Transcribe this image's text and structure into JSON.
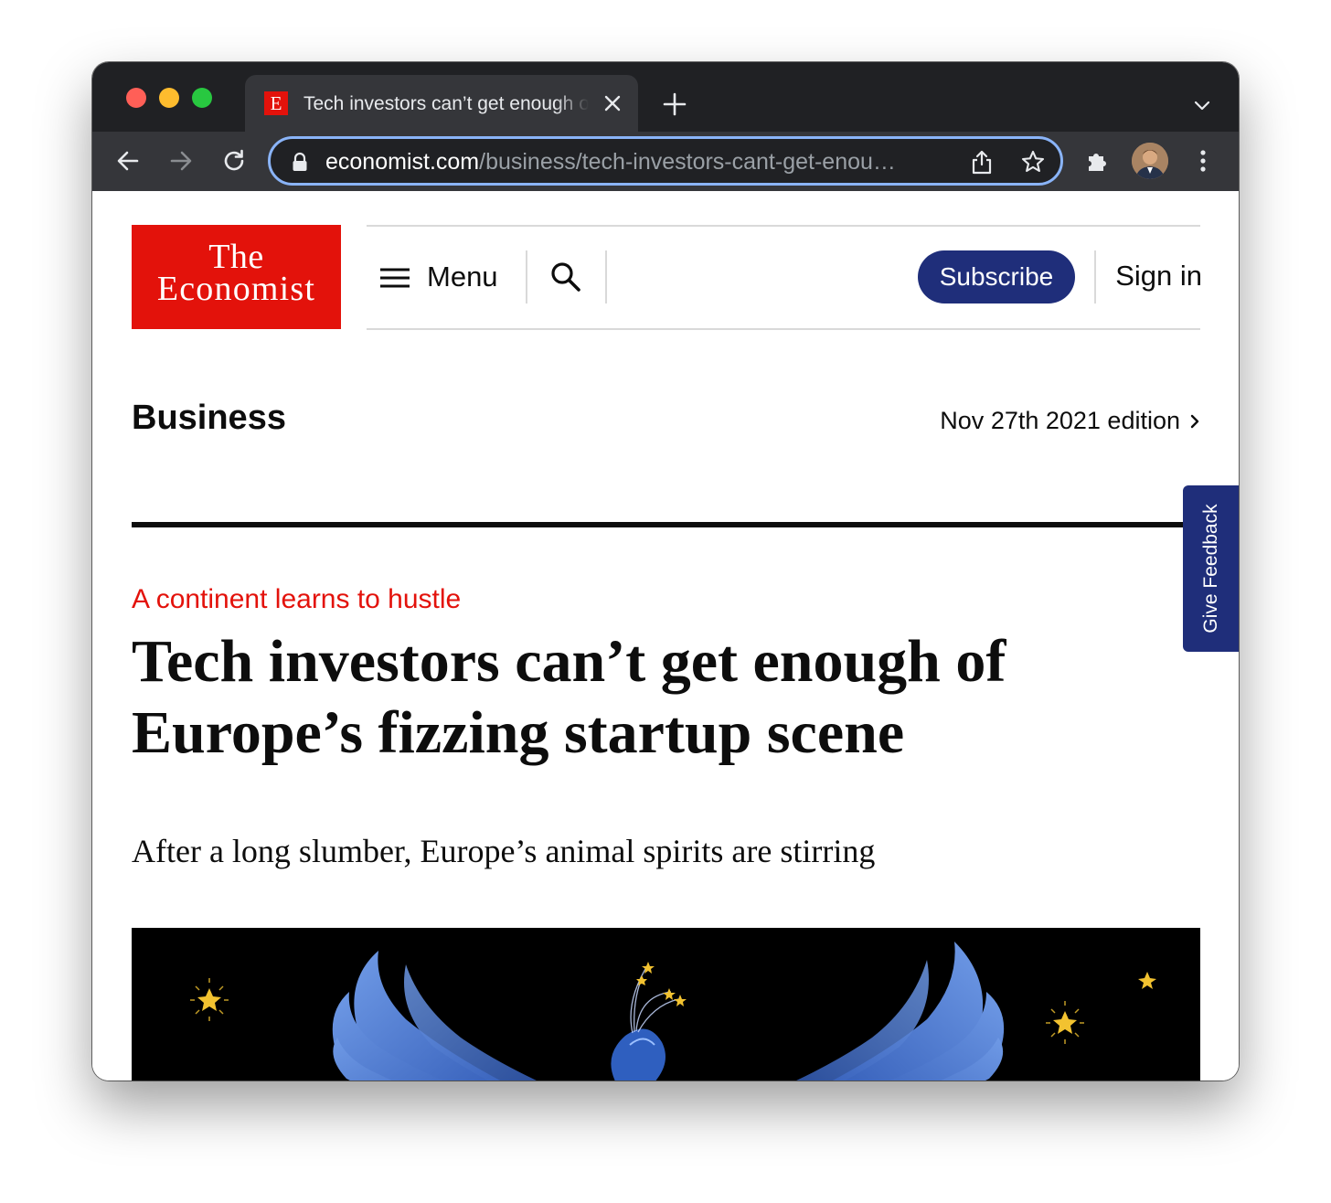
{
  "browser": {
    "tab": {
      "favicon_letter": "E",
      "title": "Tech investors can’t get enough of Europe’s fizzing startup scene"
    },
    "url": {
      "host": "economist.com",
      "path": "/business/tech-investors-cant-get-enou…"
    }
  },
  "site": {
    "logo_line1": "The",
    "logo_line2": "Economist",
    "menu_label": "Menu",
    "subscribe_label": "Subscribe",
    "signin_label": "Sign in"
  },
  "section": {
    "title": "Business",
    "edition": "Nov 27th 2021 edition"
  },
  "article": {
    "rubric": "A continent learns to hustle",
    "headline_line1": "Tech investors can’t get enough of",
    "headline_line2": "Europe’s fizzing startup scene",
    "standfirst": "After a long slumber, Europe’s animal spirits are stirring"
  },
  "feedback_tab": {
    "label": "Give Feedback"
  },
  "colors": {
    "economist_red": "#e3120b",
    "subscribe_navy": "#1f2e7a",
    "omnibox_focus": "#8ab4f8",
    "hero_background": "#000000",
    "hero_phoenix_blue": "#2f5fbf",
    "hero_star_gold": "#f2c230"
  },
  "icons": {
    "back": "arrow-left-icon",
    "forward": "arrow-right-icon",
    "reload": "reload-icon",
    "lock": "lock-icon",
    "share": "share-icon",
    "bookmark": "star-icon",
    "extensions": "puzzle-icon",
    "browser_menu": "kebab-icon",
    "site_menu": "hamburger-icon",
    "site_search": "search-icon"
  }
}
